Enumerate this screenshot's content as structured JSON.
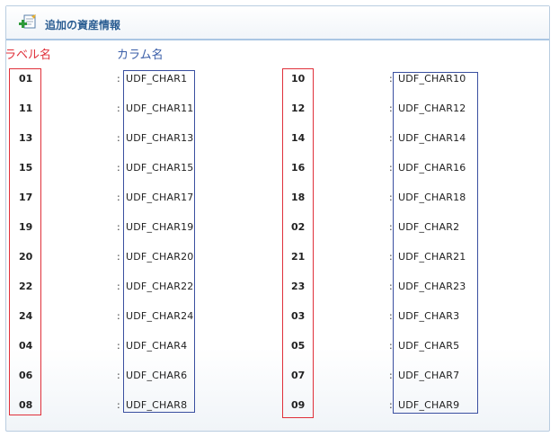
{
  "panel": {
    "title": "追加の資産情報",
    "icon": "add-document-icon"
  },
  "headers": {
    "label": "ラベル名",
    "column": "カラム名"
  },
  "colon": ":",
  "rows": [
    {
      "left_label": "01",
      "left_column": "UDF_CHAR1",
      "right_label": "10",
      "right_column": "UDF_CHAR10"
    },
    {
      "left_label": "11",
      "left_column": "UDF_CHAR11",
      "right_label": "12",
      "right_column": "UDF_CHAR12"
    },
    {
      "left_label": "13",
      "left_column": "UDF_CHAR13",
      "right_label": "14",
      "right_column": "UDF_CHAR14"
    },
    {
      "left_label": "15",
      "left_column": "UDF_CHAR15",
      "right_label": "16",
      "right_column": "UDF_CHAR16"
    },
    {
      "left_label": "17",
      "left_column": "UDF_CHAR17",
      "right_label": "18",
      "right_column": "UDF_CHAR18"
    },
    {
      "left_label": "19",
      "left_column": "UDF_CHAR19",
      "right_label": "02",
      "right_column": "UDF_CHAR2"
    },
    {
      "left_label": "20",
      "left_column": "UDF_CHAR20",
      "right_label": "21",
      "right_column": "UDF_CHAR21"
    },
    {
      "left_label": "22",
      "left_column": "UDF_CHAR22",
      "right_label": "23",
      "right_column": "UDF_CHAR23"
    },
    {
      "left_label": "24",
      "left_column": "UDF_CHAR24",
      "right_label": "03",
      "right_column": "UDF_CHAR3"
    },
    {
      "left_label": "04",
      "left_column": "UDF_CHAR4",
      "right_label": "05",
      "right_column": "UDF_CHAR5"
    },
    {
      "left_label": "06",
      "left_column": "UDF_CHAR6",
      "right_label": "07",
      "right_column": "UDF_CHAR7"
    },
    {
      "left_label": "08",
      "left_column": "UDF_CHAR8",
      "right_label": "09",
      "right_column": "UDF_CHAR9"
    }
  ],
  "colors": {
    "label_highlight": "#e0303a",
    "column_highlight": "#3a4fa0",
    "title": "#2a5d92"
  }
}
